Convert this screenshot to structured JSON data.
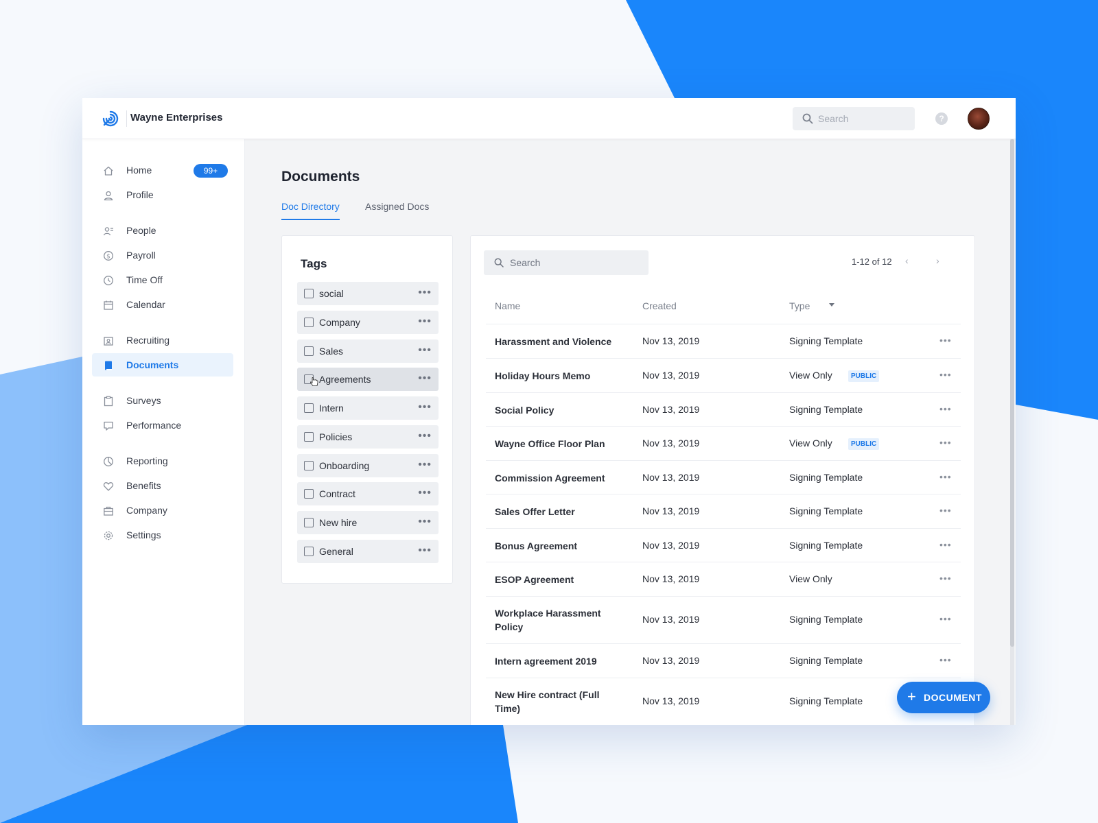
{
  "colors": {
    "accent": "#1f7ae8",
    "background_blue": "#1a86fb",
    "background_light_blue": "#8cc0fb"
  },
  "topbar": {
    "brand": "Wayne Enterprises",
    "search_placeholder": "Search",
    "help_label": "?"
  },
  "sidebar": {
    "items": [
      {
        "label": "Home",
        "icon": "home-icon",
        "badge": "99+"
      },
      {
        "label": "Profile",
        "icon": "user-icon"
      },
      {
        "label": "People",
        "icon": "people-icon"
      },
      {
        "label": "Payroll",
        "icon": "dollar-icon"
      },
      {
        "label": "Time Off",
        "icon": "clock-icon"
      },
      {
        "label": "Calendar",
        "icon": "calendar-icon"
      },
      {
        "label": "Recruiting",
        "icon": "recruiting-icon"
      },
      {
        "label": "Documents",
        "icon": "document-icon",
        "active": true
      },
      {
        "label": "Surveys",
        "icon": "clipboard-icon"
      },
      {
        "label": "Performance",
        "icon": "chat-icon"
      },
      {
        "label": "Reporting",
        "icon": "pie-chart-icon"
      },
      {
        "label": "Benefits",
        "icon": "heart-icon"
      },
      {
        "label": "Company",
        "icon": "briefcase-icon"
      },
      {
        "label": "Settings",
        "icon": "gear-icon"
      }
    ]
  },
  "main": {
    "title": "Documents",
    "tabs": [
      {
        "label": "Doc Directory",
        "active": true
      },
      {
        "label": "Assigned Docs",
        "active": false
      }
    ]
  },
  "tags": {
    "title": "Tags",
    "more_label": "•••",
    "items": [
      "social",
      "Company",
      "Sales",
      "Agreements",
      "Intern",
      "Policies",
      "Onboarding",
      "Contract",
      "New hire",
      "General"
    ],
    "hovered": "Agreements"
  },
  "docs": {
    "search_placeholder": "Search",
    "pagination": "1-12 of 12",
    "prev_label": "‹",
    "next_label": "›",
    "columns": {
      "name": "Name",
      "created": "Created",
      "type": "Type"
    },
    "more_label": "•••",
    "rows": [
      {
        "name": "Harassment and Violence",
        "created": "Nov 13, 2019",
        "type": "Signing Template",
        "badge": ""
      },
      {
        "name": "Holiday Hours Memo",
        "created": "Nov 13, 2019",
        "type": "View Only",
        "badge": "PUBLIC"
      },
      {
        "name": "Social Policy",
        "created": "Nov 13, 2019",
        "type": "Signing Template",
        "badge": ""
      },
      {
        "name": "Wayne Office Floor Plan",
        "created": "Nov 13, 2019",
        "type": "View Only",
        "badge": "PUBLIC"
      },
      {
        "name": "Commission Agreement",
        "created": "Nov 13, 2019",
        "type": "Signing Template",
        "badge": ""
      },
      {
        "name": "Sales Offer Letter",
        "created": "Nov 13, 2019",
        "type": "Signing Template",
        "badge": ""
      },
      {
        "name": "Bonus Agreement",
        "created": "Nov 13, 2019",
        "type": "Signing Template",
        "badge": ""
      },
      {
        "name": "ESOP Agreement",
        "created": "Nov 13, 2019",
        "type": "View Only",
        "badge": ""
      },
      {
        "name": "Workplace Harassment Policy",
        "created": "Nov 13, 2019",
        "type": "Signing Template",
        "badge": ""
      },
      {
        "name": "Intern agreement 2019",
        "created": "Nov 13, 2019",
        "type": "Signing Template",
        "badge": ""
      },
      {
        "name": "New Hire contract (Full Time)",
        "created": "Nov 13, 2019",
        "type": "Signing Template",
        "badge": ""
      }
    ],
    "add_button": {
      "plus": "+",
      "label": "DOCUMENT"
    }
  }
}
